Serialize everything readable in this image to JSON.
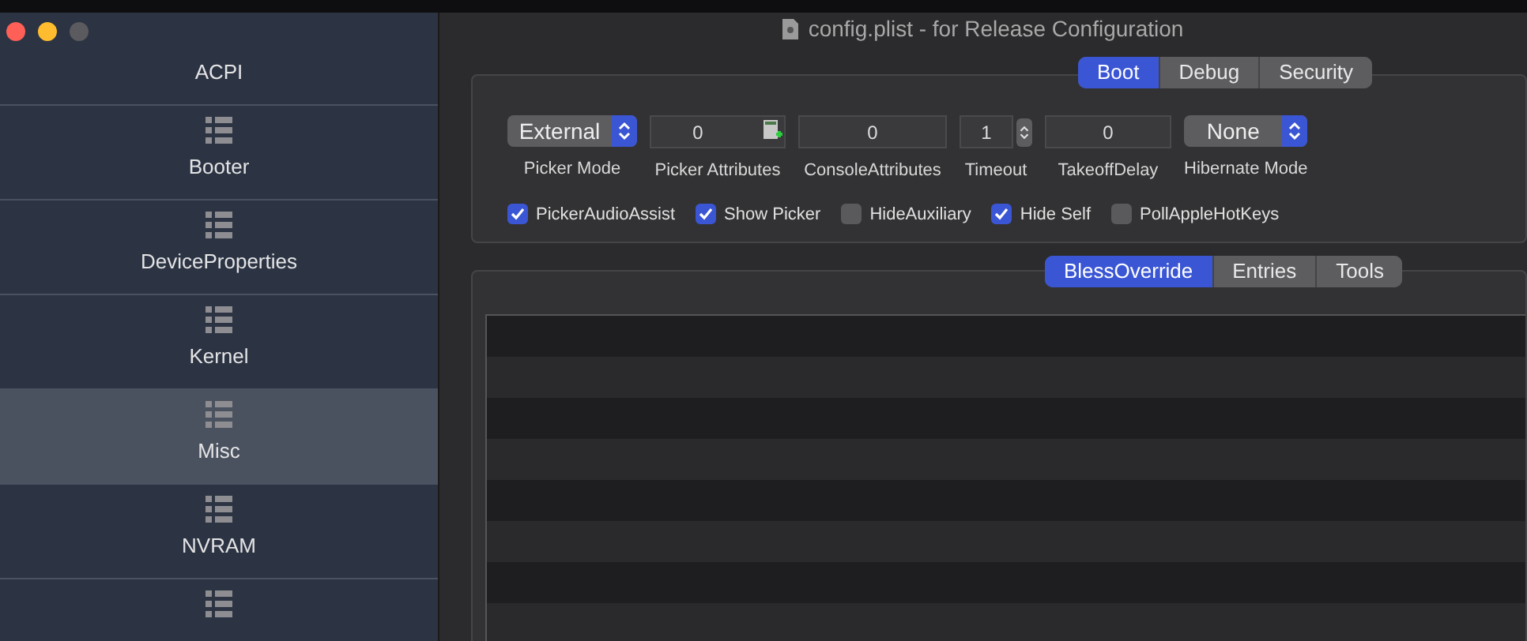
{
  "window": {
    "title": "config.plist - for Release Configuration"
  },
  "sidebar": {
    "items": [
      {
        "label": "ACPI",
        "selected": false
      },
      {
        "label": "Booter",
        "selected": false
      },
      {
        "label": "DeviceProperties",
        "selected": false
      },
      {
        "label": "Kernel",
        "selected": false
      },
      {
        "label": "Misc",
        "selected": true
      },
      {
        "label": "NVRAM",
        "selected": false
      },
      {
        "selected": false
      }
    ]
  },
  "top_tabs": [
    {
      "label": "Boot",
      "selected": true
    },
    {
      "label": "Debug",
      "selected": false
    },
    {
      "label": "Security",
      "selected": false
    }
  ],
  "fields": [
    {
      "kind": "popup",
      "value": "External",
      "label": "Picker Mode"
    },
    {
      "kind": "calc",
      "value": "0",
      "label": "Picker Attributes"
    },
    {
      "kind": "number",
      "value": "0",
      "label": "ConsoleAttributes"
    },
    {
      "kind": "stepper",
      "value": "1",
      "label": "Timeout"
    },
    {
      "kind": "number",
      "value": "0",
      "label": "TakeoffDelay"
    },
    {
      "kind": "popup",
      "value": "None",
      "label": "Hibernate Mode"
    }
  ],
  "checkboxes": [
    {
      "label": "PickerAudioAssist",
      "checked": true
    },
    {
      "label": "Show Picker",
      "checked": true
    },
    {
      "label": "HideAuxiliary",
      "checked": false
    },
    {
      "label": "Hide Self",
      "checked": true
    },
    {
      "label": "PollAppleHotKeys",
      "checked": false
    }
  ],
  "bottom_tabs": [
    {
      "label": "BlessOverride",
      "selected": true
    },
    {
      "label": "Entries",
      "selected": false
    },
    {
      "label": "Tools",
      "selected": false
    }
  ]
}
